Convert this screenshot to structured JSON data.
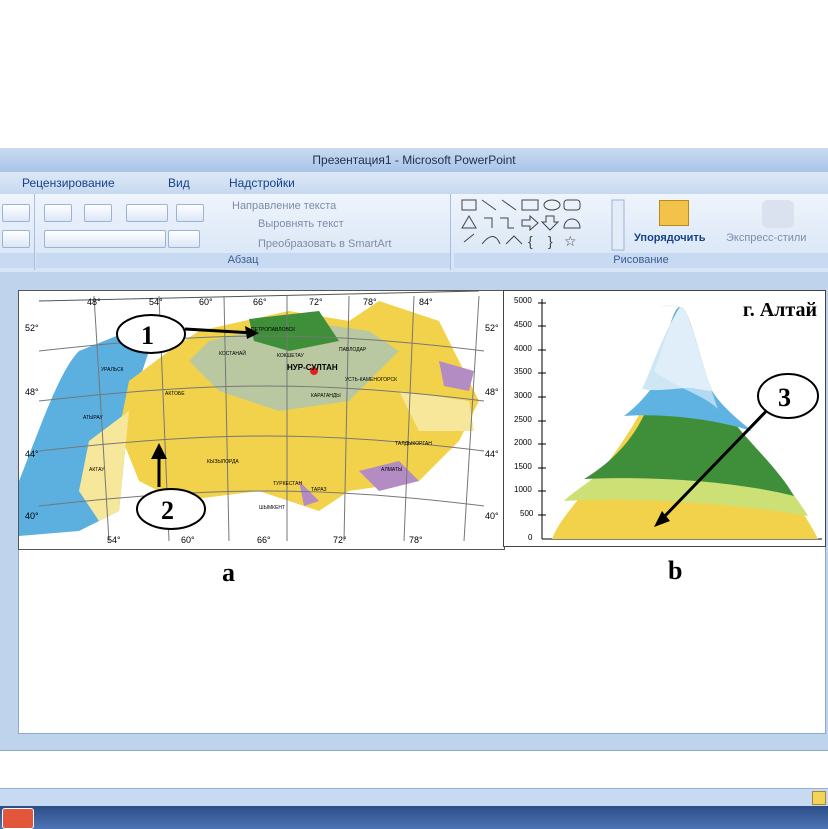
{
  "window": {
    "title": "Презентация1 - Microsoft PowerPoint"
  },
  "tabs": [
    "Рецензирование",
    "Вид",
    "Надстройки"
  ],
  "ribbon": {
    "paragraph": {
      "text_direction": "Направление текста",
      "align_text": "Выровнять текст",
      "convert_smartart": "Преобразовать в SmartArt",
      "group_label": "Абзац"
    },
    "drawing": {
      "arrange": "Упорядочить",
      "quick_styles": "Экспресс-стили",
      "group_label": "Рисование"
    }
  },
  "slide": {
    "map": {
      "label": "a",
      "lon_top": [
        "48°",
        "54°",
        "60°",
        "66°",
        "72°",
        "78°",
        "84°"
      ],
      "lon_bottom": [
        "54°",
        "60°",
        "66°",
        "72°",
        "78°"
      ],
      "lat_left": [
        "52°",
        "48°",
        "44°",
        "40°"
      ],
      "lat_right": [
        "52°",
        "48°",
        "44°",
        "40°"
      ],
      "cities": [
        "ПЕТРОПАВЛОВСК",
        "КОСТАНАЙ",
        "КОКШЕТАУ",
        "ПАВЛОДАР",
        "НУР-СУЛТАН",
        "УРАЛЬСК",
        "АКТОБЕ",
        "УСТЬ-КАМЕНОГОРСК",
        "КАРАГАНДЫ",
        "АТЫРАУ",
        "ТАЛДЫКОРГАН",
        "АКТАУ",
        "КЫЗЫЛОРДА",
        "АЛМАТЫ",
        "ТУРКЕСТАН",
        "ТАРАЗ",
        "ШЫМКЕНТ"
      ],
      "markers": [
        "1",
        "2"
      ]
    },
    "profile": {
      "label": "b",
      "title": "г. Алтай",
      "marker": "3",
      "y_ticks": [
        "5000",
        "4500",
        "4000",
        "3500",
        "3000",
        "2500",
        "2000",
        "1500",
        "1000",
        "500",
        "0"
      ]
    }
  },
  "colors": {
    "steppe_yellow": "#f2d24a",
    "forest_green": "#3f8f3a",
    "desert_light": "#f6e79a",
    "mountain_purple": "#b48cc4",
    "water_blue": "#49a7dd"
  }
}
